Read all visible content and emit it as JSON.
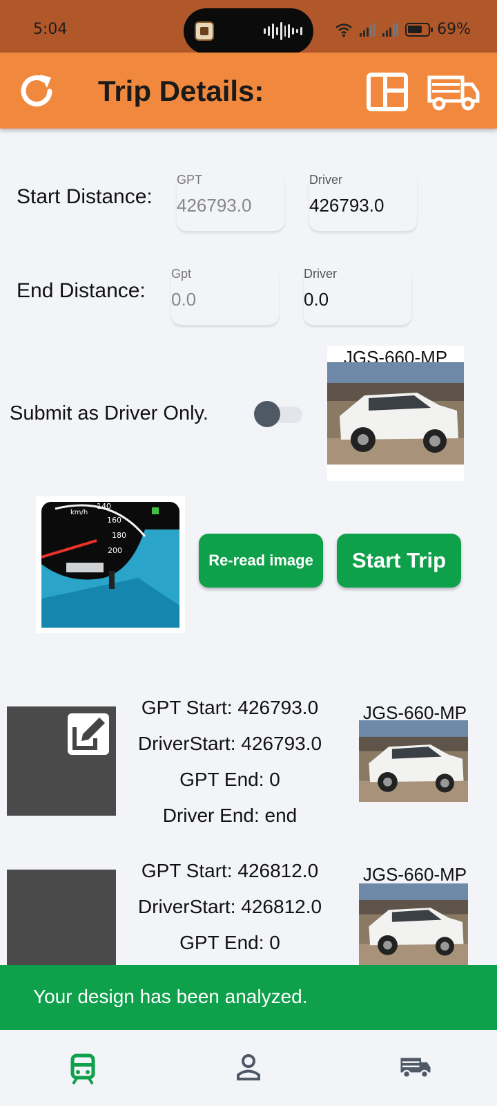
{
  "status_bar": {
    "time": "5:04",
    "battery": "69%"
  },
  "header": {
    "title": "Trip Details:"
  },
  "start_distance": {
    "label": "Start Distance:",
    "gpt_label": "GPT",
    "gpt_value": "426793.0",
    "driver_label": "Driver",
    "driver_value": "426793.0"
  },
  "end_distance": {
    "label": "End Distance:",
    "gpt_label": "Gpt",
    "gpt_value": "0.0",
    "driver_label": "Driver",
    "driver_value": "0.0"
  },
  "driver_only": {
    "label": "Submit as Driver Only.",
    "enabled": false
  },
  "vehicle": {
    "plate": "JGS-660-MP"
  },
  "buttons": {
    "reread": "Re-read image",
    "start_trip": "Start Trip"
  },
  "trips": [
    {
      "gpt_start": "GPT Start: 426793.0",
      "driver_start": "DriverStart: 426793.0",
      "gpt_end": "GPT End: 0",
      "driver_end": "Driver End: end",
      "plate": "JGS-660-MP"
    },
    {
      "gpt_start": "GPT Start: 426812.0",
      "driver_start": "DriverStart: 426812.0",
      "gpt_end": "GPT End: 0",
      "plate": "JGS-660-MP"
    }
  ],
  "snackbar": {
    "message": "Your design has been analyzed."
  },
  "colors": {
    "header": "#f0883e",
    "status_bar": "#b0582a",
    "primary_green": "#0ea04a",
    "nav_active": "#0ea04a",
    "nav_inactive": "#4f5966"
  },
  "icons": [
    "refresh-icon",
    "layout-icon",
    "truck-icon",
    "edit-icon",
    "train-icon",
    "person-icon"
  ]
}
